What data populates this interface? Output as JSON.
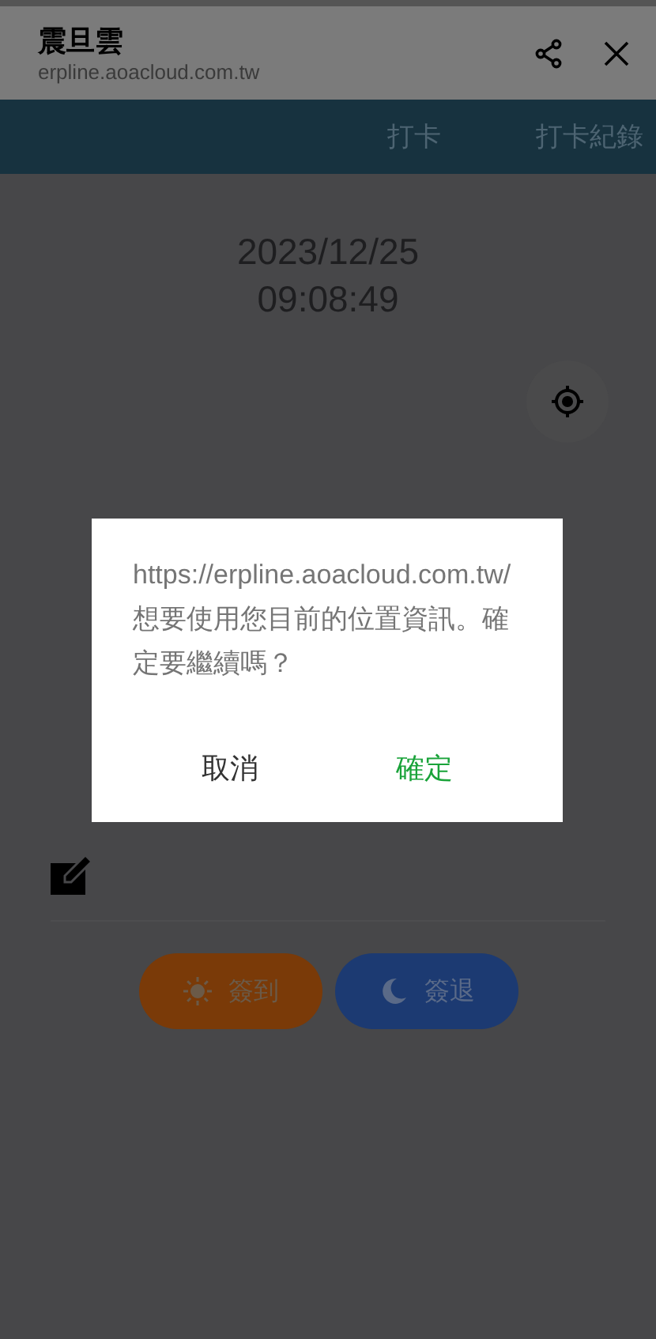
{
  "header": {
    "title": "震旦雲",
    "url": "erpline.aoacloud.com.tw"
  },
  "tabs": [
    {
      "label": "打卡"
    },
    {
      "label": "打卡紀錄"
    }
  ],
  "clock": {
    "date": "2023/12/25",
    "time": "09:08:49"
  },
  "actions": [
    {
      "label": "簽到",
      "kind": "check-in"
    },
    {
      "label": "簽退",
      "kind": "check-out"
    }
  ],
  "dialog": {
    "message": "https://erpline.aoacloud.com.tw/想要使用您目前的位置資訊。確定要繼續嗎？",
    "buttons": [
      {
        "label": "取消",
        "kind": "cancel"
      },
      {
        "label": "確定",
        "kind": "confirm"
      }
    ]
  }
}
